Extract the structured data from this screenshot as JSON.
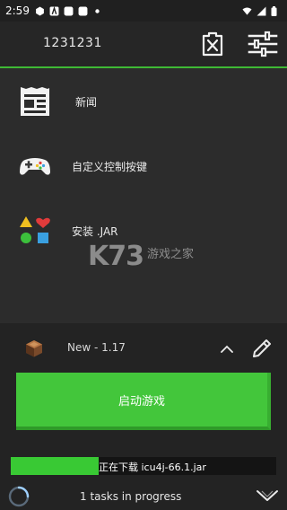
{
  "status_bar": {
    "time": "2:59",
    "left_icons": [
      "app-notification-icon",
      "font-notification-icon",
      "square-notification-icon",
      "square-notification-icon",
      "dot-icon"
    ],
    "right_icons": [
      "wifi-icon",
      "signal-icon",
      "battery-icon"
    ]
  },
  "header": {
    "title": "1231231",
    "delete_icon": "delete-account-icon",
    "settings_icon": "sliders-icon"
  },
  "menu": {
    "items": [
      {
        "label": "新闻",
        "icon": "newspaper-icon"
      },
      {
        "label": "自定义控制按键",
        "icon": "gamepad-icon"
      },
      {
        "label": "安装 .JAR",
        "icon": "shapes-icon"
      }
    ]
  },
  "watermark": {
    "main": "K73",
    "sub": "游戏之家"
  },
  "version": {
    "label": "New - 1.17",
    "icon": "crafting-table-icon"
  },
  "launch": {
    "label": "启动游戏"
  },
  "download": {
    "text": "正在下载 icu4j-66.1.jar",
    "progress": 0.33
  },
  "tasks": {
    "label": "1 tasks in progress"
  },
  "colors": {
    "accent": "#43c63b",
    "header_border": "#3fb935",
    "background": "#2c2c2c",
    "panel": "#232323"
  }
}
